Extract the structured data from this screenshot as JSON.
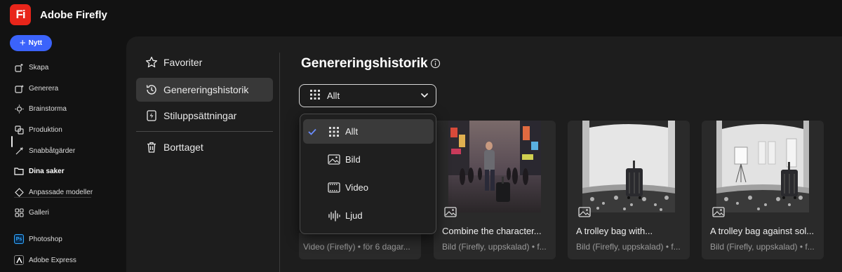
{
  "app": {
    "logo_text": "Fi",
    "title": "Adobe Firefly",
    "brand_color": "#e8251a",
    "accent": "#3b63fb"
  },
  "leftnav": {
    "new_label": "Nytt",
    "items": [
      {
        "label": "Skapa",
        "icon": "create-icon"
      },
      {
        "label": "Generera",
        "icon": "generate-icon"
      },
      {
        "label": "Brainstorma",
        "icon": "brainstorm-icon"
      },
      {
        "label": "Produktion",
        "icon": "production-icon"
      },
      {
        "label": "Snabbåtgärder",
        "icon": "quick-actions-icon"
      },
      {
        "label": "Dina saker",
        "icon": "folder-icon",
        "active": true
      },
      {
        "label": "Anpassade modeller",
        "icon": "custom-models-icon"
      },
      {
        "label": "Galleri",
        "icon": "gallery-icon"
      }
    ],
    "apps": [
      {
        "label": "Photoshop",
        "badge": "Ps",
        "color": "#0a2a4a"
      },
      {
        "label": "Adobe Express",
        "badge": "Ex",
        "color": "#1a1a1a"
      }
    ]
  },
  "sidebar": {
    "items": [
      {
        "label": "Favoriter",
        "icon": "star-icon"
      },
      {
        "label": "Genereringshistorik",
        "icon": "history-icon",
        "selected": true
      },
      {
        "label": "Stiluppsättningar",
        "icon": "style-kit-icon"
      },
      {
        "label": "Borttaget",
        "icon": "trash-icon"
      }
    ]
  },
  "main": {
    "title": "Genereringshistorik",
    "filter": {
      "selected": "Allt"
    }
  },
  "dropdown": {
    "options": [
      {
        "label": "Allt",
        "icon": "grid-icon",
        "selected": true
      },
      {
        "label": "Bild",
        "icon": "image-icon"
      },
      {
        "label": "Video",
        "icon": "video-icon"
      },
      {
        "label": "Ljud",
        "icon": "audio-icon"
      }
    ]
  },
  "cards": [
    {
      "title": "Combine the character...",
      "meta": "Bild (Firefly, uppskalad) • f..."
    },
    {
      "title": "A trolley bag with...",
      "meta": "Bild (Firefly, uppskalad) • f..."
    },
    {
      "title": "A trolley bag against sol...",
      "meta": "Bild (Firefly, uppskalad) • f..."
    }
  ],
  "card_partial": {
    "meta": "Video (Firefly) • för 6 dagar..."
  }
}
